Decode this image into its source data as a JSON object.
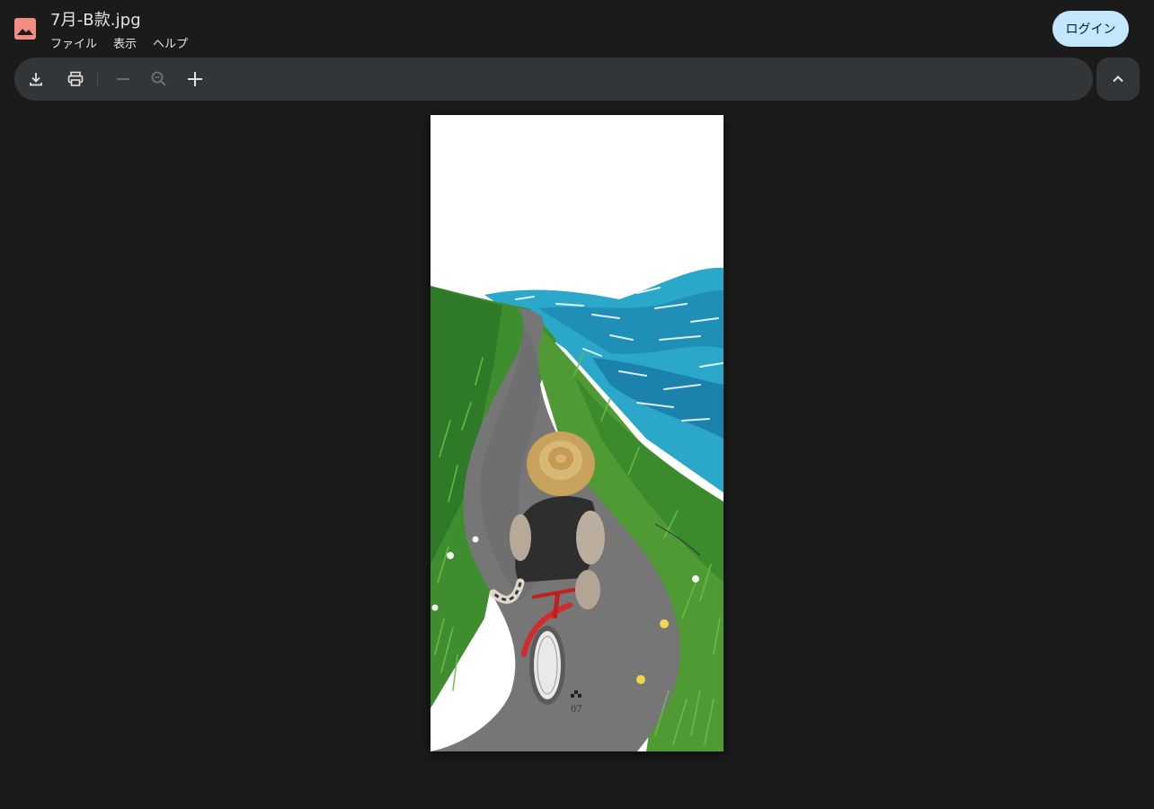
{
  "app": {
    "icon": "image-file-icon",
    "accent_color": "#f28b82",
    "file_title": "7月-B款.jpg"
  },
  "menu": [
    "ファイル",
    "表示",
    "ヘルプ"
  ],
  "login_label": "ログイン",
  "toolbar": {
    "icons": [
      "download-icon",
      "print-icon",
      "zoom-out-icon",
      "zoom-reset-icon",
      "zoom-in-icon"
    ],
    "collapse_icon": "chevron-up-icon"
  },
  "image": {
    "page_number": "07"
  }
}
